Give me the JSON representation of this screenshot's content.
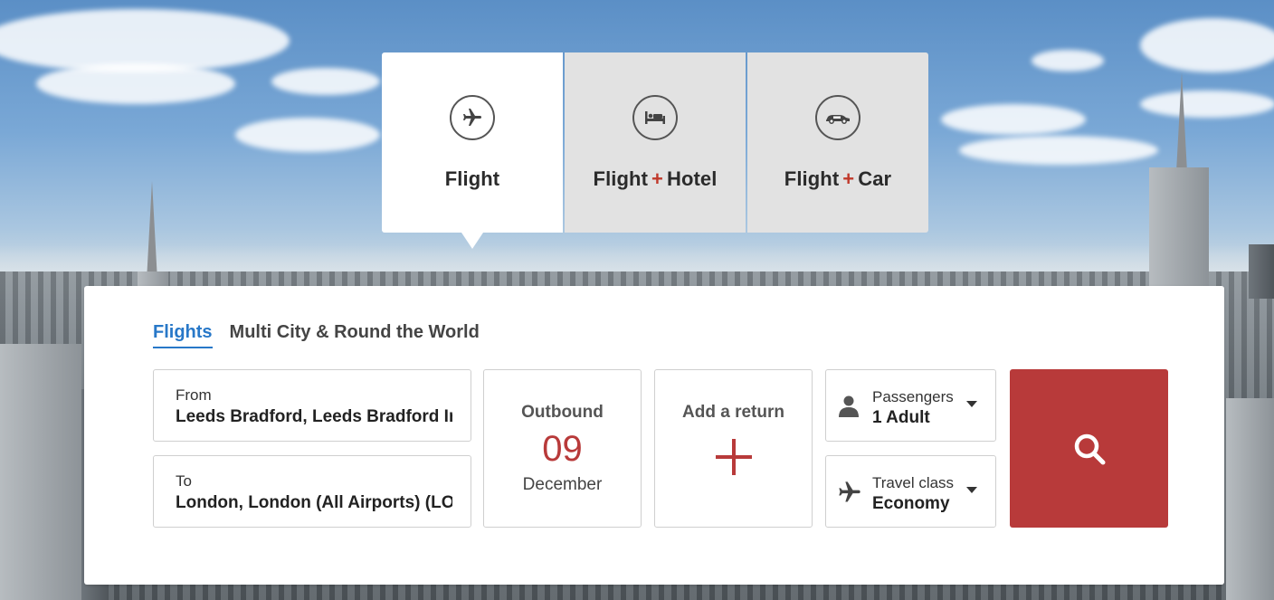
{
  "product_tabs": [
    {
      "label": "Flight",
      "icon": "airplane-icon",
      "active": true
    },
    {
      "label_a": "Flight",
      "plus": "+",
      "label_b": "Hotel",
      "icon": "bed-icon",
      "active": false
    },
    {
      "label_a": "Flight",
      "plus": "+",
      "label_b": "Car",
      "icon": "car-icon",
      "active": false
    }
  ],
  "subtabs": [
    {
      "label": "Flights",
      "active": true
    },
    {
      "label": "Multi City & Round the World",
      "active": false
    }
  ],
  "from": {
    "label": "From",
    "value": "Leeds Bradford, Leeds Bradford International (LBA)"
  },
  "to": {
    "label": "To",
    "value": "London, London (All Airports) (LON)"
  },
  "outbound": {
    "label": "Outbound",
    "day": "09",
    "month": "December"
  },
  "return": {
    "label": "Add a return",
    "icon": "plus-icon"
  },
  "passengers": {
    "label": "Passengers",
    "value": "1 Adult",
    "icon": "person-icon"
  },
  "travel_class": {
    "label": "Travel class",
    "value": "Economy",
    "icon": "airplane-icon"
  },
  "search": {
    "icon": "search-icon"
  },
  "colors": {
    "accent_red": "#b83a3a",
    "link_blue": "#2878c8",
    "tab_inactive": "#e2e2e2"
  }
}
